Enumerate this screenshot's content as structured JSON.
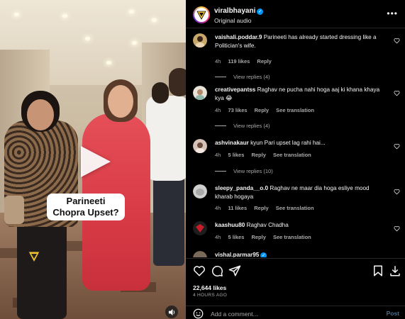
{
  "post": {
    "username": "viralbhayani",
    "subtitle": "Original audio",
    "verified": true
  },
  "video": {
    "caption": "Parineeti Chopra Upset?",
    "watermark": "viralbhayani-logo"
  },
  "comments": [
    {
      "user": "vaishali.poddar.9",
      "text": "Parineeti has already started dressing like a Politician's wife.",
      "time": "4h",
      "likes": "119 likes",
      "reply": "Reply",
      "translation": "",
      "view_replies": "View replies (4)"
    },
    {
      "user": "creativepantss",
      "text": "Raghav ne pucha nahi hoga aaj ki khana khaya kya 😂",
      "time": "4h",
      "likes": "73 likes",
      "reply": "Reply",
      "translation": "See translation",
      "view_replies": "View replies (4)"
    },
    {
      "user": "ashvinakaur",
      "text": "kyun Pari upset lag rahi hai...",
      "time": "4h",
      "likes": "5 likes",
      "reply": "Reply",
      "translation": "See translation",
      "view_replies": "View replies (10)"
    },
    {
      "user": "sleepy_panda__o.0",
      "text": "Raghav ne maar dia hoga esliye mood kharab hogaya",
      "time": "4h",
      "likes": "11 likes",
      "reply": "Reply",
      "translation": "See translation",
      "view_replies": ""
    },
    {
      "user": "kaashuu80",
      "text": "Raghav Chadha",
      "time": "4h",
      "likes": "5 likes",
      "reply": "Reply",
      "translation": "See translation",
      "view_replies": ""
    },
    {
      "user": "vishal.parmar95",
      "text": "",
      "time": "",
      "likes": "",
      "reply": "",
      "translation": "",
      "view_replies": ""
    }
  ],
  "actions": {
    "likes": "22,644 likes",
    "time": "4 HOURS AGO",
    "icons": [
      "heart-icon",
      "comment-icon",
      "share-icon",
      "save-icon",
      "download-icon"
    ]
  },
  "add_comment": {
    "placeholder": "Add a comment...",
    "post_label": "Post"
  },
  "colors": {
    "background": "#000000",
    "accent": "#0095f6",
    "muted_text": "#a8a8a8",
    "divider": "#262626",
    "caption_bg": "#ffffff"
  }
}
